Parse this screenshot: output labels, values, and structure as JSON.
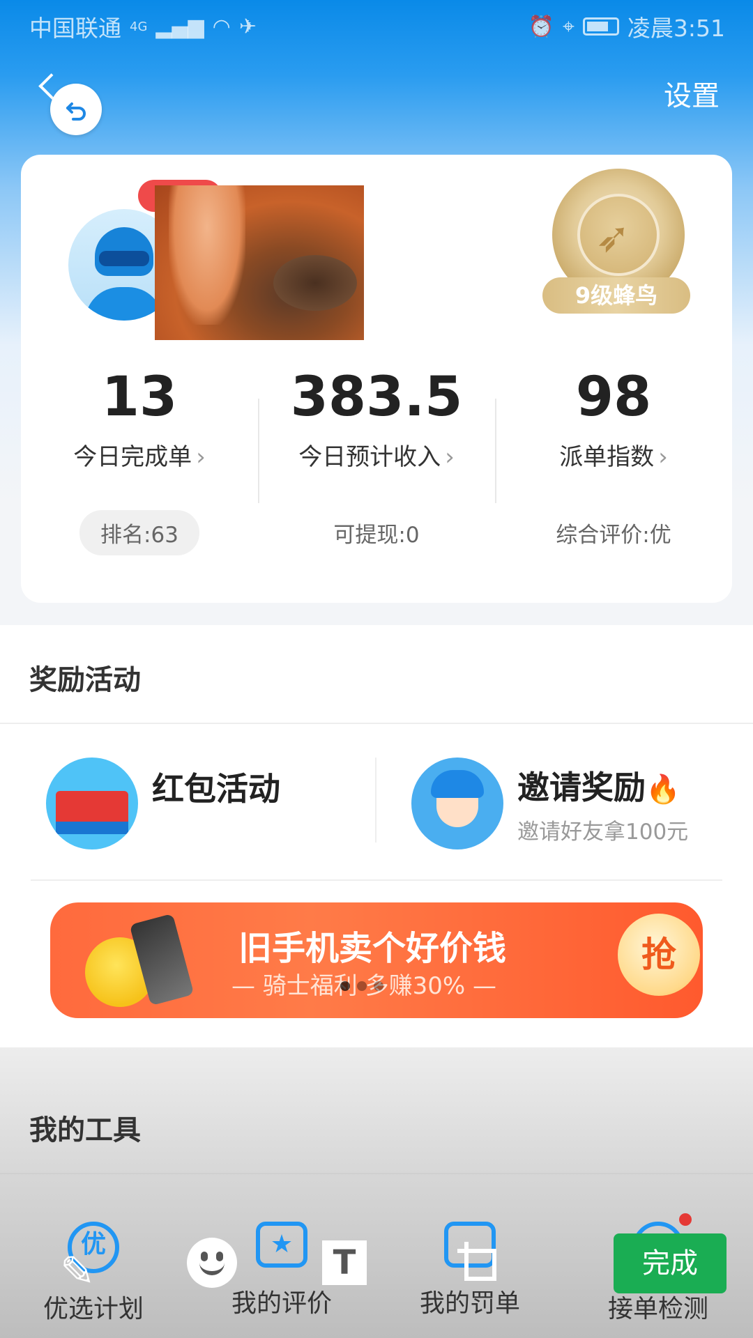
{
  "status_bar": {
    "carrier": "中国联通",
    "network": "4G",
    "time": "凌晨3:51"
  },
  "header": {
    "settings_label": "设置"
  },
  "profile": {
    "medal_label": "9级蜂鸟"
  },
  "stats": [
    {
      "value": "13",
      "label": "今日完成单",
      "sub": "排名:63"
    },
    {
      "value": "383.5",
      "label": "今日预计收入",
      "sub": "可提现:0"
    },
    {
      "value": "98",
      "label": "派单指数",
      "sub": "综合评价:优"
    }
  ],
  "rewards": {
    "title": "奖励活动",
    "items": [
      {
        "title": "红包活动",
        "subtitle": ""
      },
      {
        "title": "邀请奖励",
        "subtitle": "邀请好友拿100元"
      }
    ],
    "banner": {
      "title": "旧手机卖个好价钱",
      "subtitle": "— 骑士福利 多赚30% —",
      "button": "抢"
    }
  },
  "tools": {
    "title": "我的工具",
    "items": [
      {
        "label": "优选计划",
        "icon_text": "优"
      },
      {
        "label": "我的评价",
        "icon_text": "★"
      },
      {
        "label": "我的罚单",
        "icon_text": ""
      },
      {
        "label": "接单检测",
        "icon_text": ""
      }
    ]
  },
  "editor": {
    "text_tool": "T",
    "done_label": "完成"
  },
  "icons": [
    "back-icon",
    "signal-icon",
    "wifi-icon",
    "alarm-icon",
    "location-icon",
    "battery-icon",
    "chevron-right-icon",
    "flame-icon",
    "pen-icon",
    "emoji-icon",
    "crop-icon"
  ]
}
